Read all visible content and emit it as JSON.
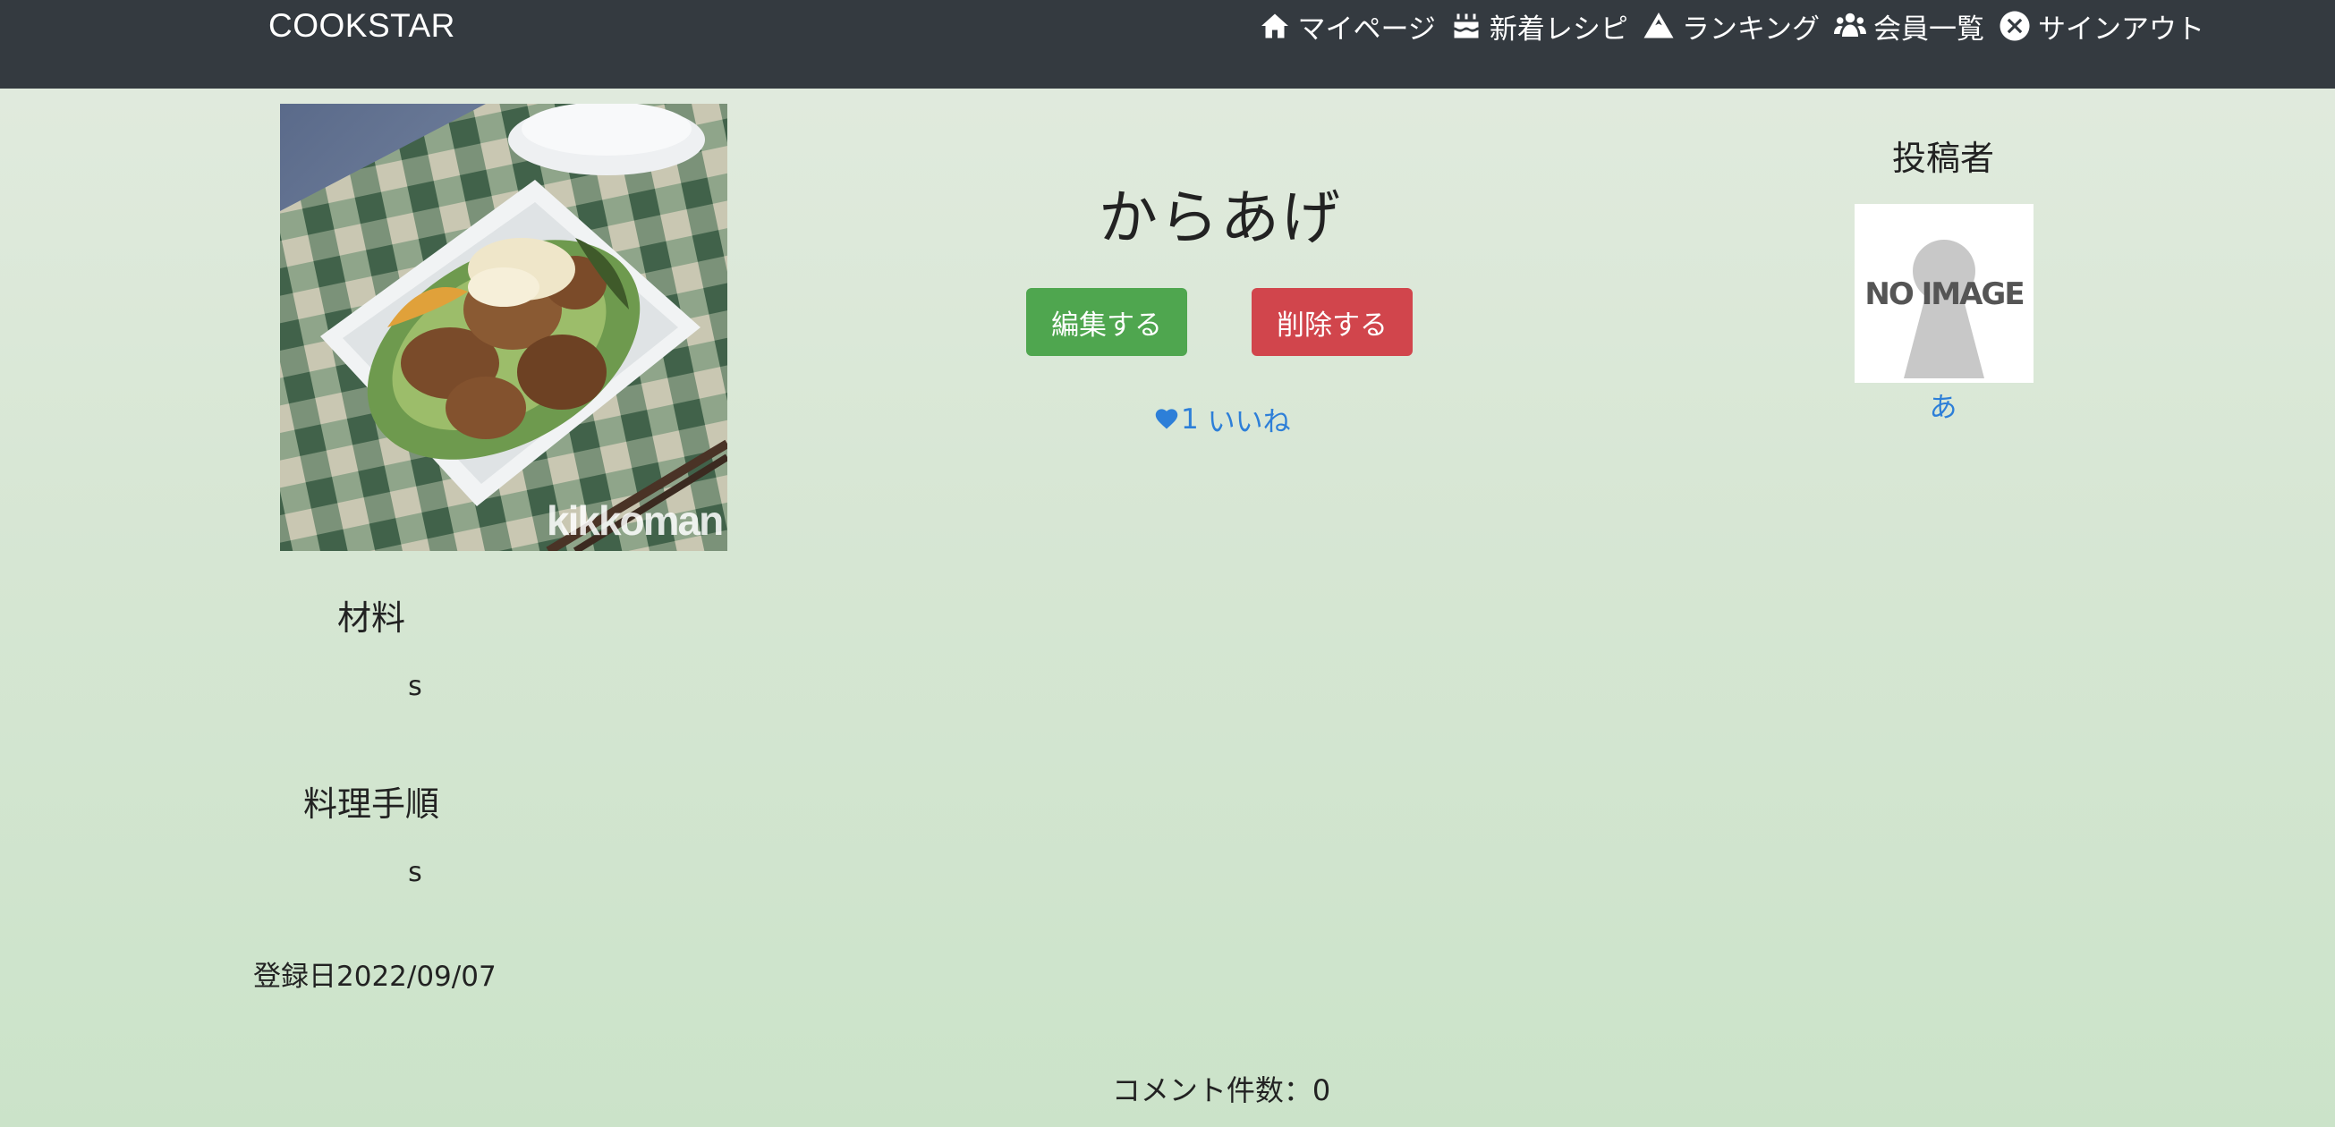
{
  "navbar": {
    "brand": "COOKSTAR",
    "items": [
      {
        "label": "マイページ",
        "icon": "home-icon"
      },
      {
        "label": "新着レシピ",
        "icon": "cake-icon"
      },
      {
        "label": "ランキング",
        "icon": "mountain-icon"
      },
      {
        "label": "会員一覧",
        "icon": "users-icon"
      },
      {
        "label": "サインアウト",
        "icon": "close-circle-icon"
      }
    ]
  },
  "recipe": {
    "title": "からあげ",
    "image_watermark": "kikkoman",
    "ingredients_heading": "材料",
    "ingredients_text": "s",
    "steps_heading": "料理手順",
    "steps_text": "s",
    "registered_label": "登録日",
    "registered_date": "2022/09/07"
  },
  "actions": {
    "edit_label": "編集する",
    "delete_label": "削除する",
    "edit_color": "#4fa64f",
    "delete_color": "#d1454c"
  },
  "like": {
    "count": "1",
    "label": " いいね",
    "color": "#2d7fd8"
  },
  "poster": {
    "heading": "投稿者",
    "avatar_text": "NO IMAGE",
    "name": "あ"
  },
  "comments": {
    "count_label": "コメント件数：0"
  },
  "colors": {
    "navbar_bg": "#343a40",
    "link": "#2d7fd8"
  }
}
